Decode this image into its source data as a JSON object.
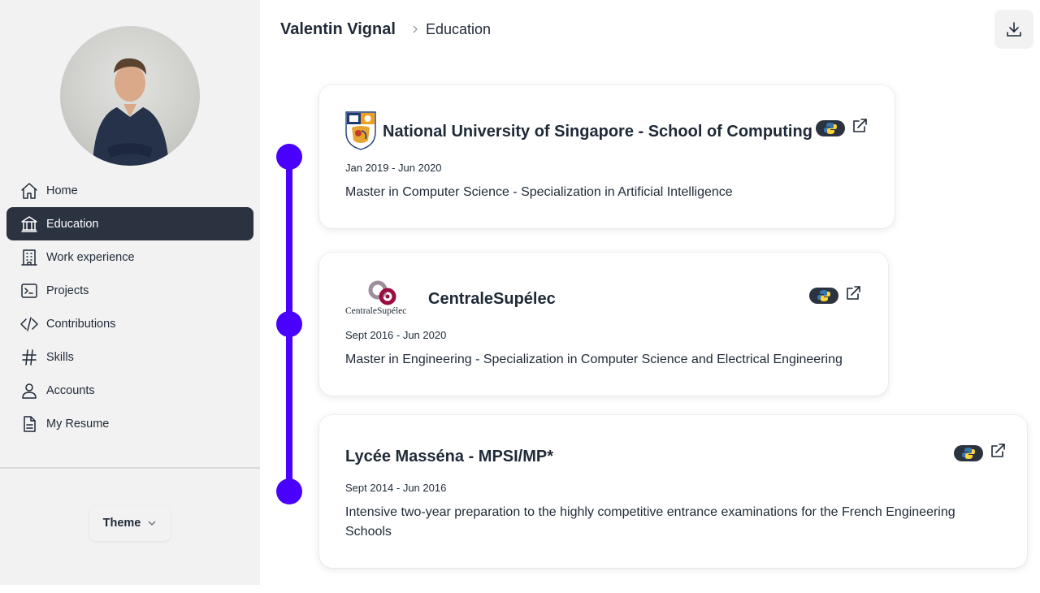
{
  "sidebar": {
    "avatar_alt": "Profile photo",
    "items": [
      {
        "label": "Home",
        "icon": "home-icon",
        "active": false
      },
      {
        "label": "Education",
        "icon": "bank-icon",
        "active": true
      },
      {
        "label": "Work experience",
        "icon": "building-icon",
        "active": false
      },
      {
        "label": "Projects",
        "icon": "terminal-icon",
        "active": false
      },
      {
        "label": "Contributions",
        "icon": "code-icon",
        "active": false
      },
      {
        "label": "Skills",
        "icon": "hash-icon",
        "active": false
      },
      {
        "label": "Accounts",
        "icon": "user-icon",
        "active": false
      },
      {
        "label": "My Resume",
        "icon": "document-icon",
        "active": false
      }
    ],
    "theme_label": "Theme"
  },
  "header": {
    "breadcrumb_root": "Valentin Vignal",
    "breadcrumb_current": "Education",
    "download_icon": "download-icon"
  },
  "education": [
    {
      "school": "National University of Singapore - School of Computing",
      "dates": "Jan 2019 - Jun 2020",
      "description": "Master in Computer Science - Specialization in Artificial Intelligence",
      "logo": "nus-crest-logo",
      "badge": "python-icon"
    },
    {
      "school": "CentraleSupélec",
      "dates": "Sept 2016 - Jun 2020",
      "description": "Master in Engineering - Specialization in Computer Science and Electrical Engineering",
      "logo": "centralesupelec-logo",
      "logo_text": "CentraleSupélec",
      "badge": "python-icon"
    },
    {
      "school": "Lycée Masséna - MPSI/MP*",
      "dates": "Sept 2014 - Jun 2016",
      "description": "Intensive two-year preparation to the highly competitive entrance examinations for the French Engineering Schools",
      "badge": "python-icon"
    }
  ],
  "colors": {
    "accent": "#4a00ff",
    "sidebar_bg": "#f2f2f2",
    "active_item_bg": "#2b3240",
    "text": "#1f2937"
  }
}
